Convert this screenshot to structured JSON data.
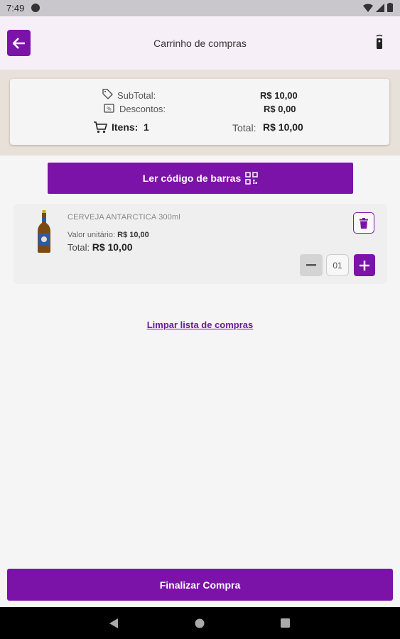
{
  "status_bar": {
    "time": "7:49"
  },
  "header": {
    "title": "Carrinho de compras"
  },
  "summary": {
    "subtotal_label": "SubTotal:",
    "subtotal_value": "R$ 10,00",
    "discount_label": "Descontos:",
    "discount_value": "R$ 0,00",
    "items_label": "Itens:",
    "items_count": "1",
    "total_label": "Total:",
    "total_value": "R$ 10,00"
  },
  "scan_button": {
    "label": "Ler código de barras"
  },
  "cart_items": [
    {
      "name": "CERVEJA ANTARCTICA 300ml",
      "unit_label": "Valor unitário:",
      "unit_price": "R$ 10,00",
      "total_label": "Total:",
      "total": "R$ 10,00",
      "quantity": "01"
    }
  ],
  "clear_link": {
    "label": "Limpar lista de compras"
  },
  "finish_button": {
    "label": "Finalizar Compra"
  },
  "colors": {
    "accent": "#7b13a8",
    "summary_band": "#e8e1d9",
    "header_bg": "#f7eff8"
  }
}
